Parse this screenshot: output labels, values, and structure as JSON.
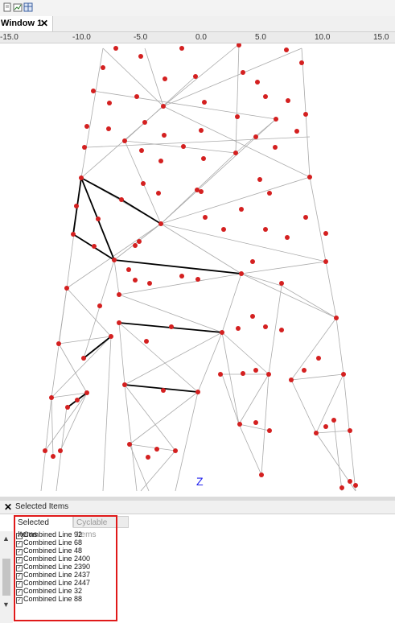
{
  "toolbar": {
    "icons": [
      "save-icon",
      "open-icon",
      "grid-icon"
    ]
  },
  "document_tab": {
    "label": "Window 1",
    "close_glyph": "✕"
  },
  "ruler": {
    "labels": [
      "-15.0",
      "-10.0",
      "-5.0",
      "0.0",
      "5.0",
      "10.0",
      "15.0"
    ]
  },
  "viewport": {
    "axis_label": "Z",
    "node_color": "#d42020",
    "member_color": "#aaaaaa",
    "selected_color": "#000000",
    "axis_color": "#2222ee"
  },
  "panel": {
    "close_glyph": "✕",
    "title": "Selected Items",
    "tabs": [
      {
        "label": "Selected Items",
        "active": true
      },
      {
        "label": "Cyclable Items",
        "active": false
      }
    ],
    "items": [
      "Combined Line 92",
      "Combined Line 68",
      "Combined Line 48",
      "Combined Line 2400",
      "Combined Line 2390",
      "Combined Line 2437",
      "Combined Line 2447",
      "Combined Line 32",
      "Combined Line 88"
    ],
    "highlight_color": "#e01a1a"
  }
}
